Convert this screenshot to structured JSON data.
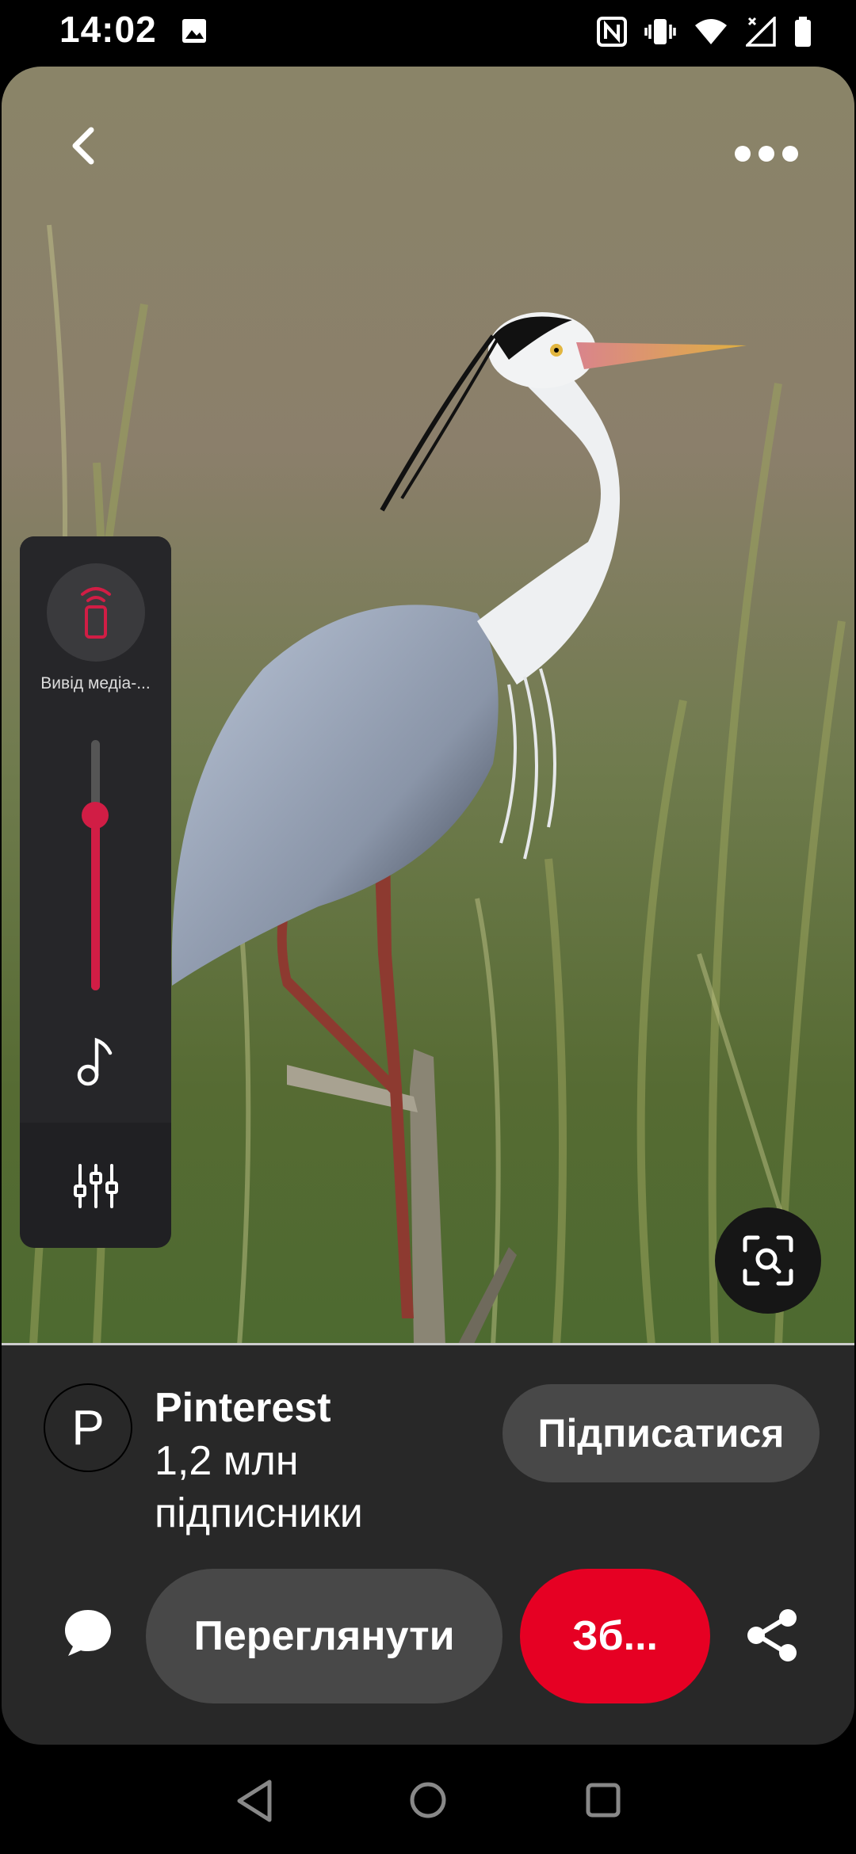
{
  "status_bar": {
    "time": "14:02",
    "icons": [
      "image-icon",
      "nfc-icon",
      "vibrate-icon",
      "wifi-icon",
      "signal-icon",
      "battery-icon"
    ]
  },
  "pin": {
    "image_subject": "grey-heron-photo",
    "actions": {
      "back_icon": "chevron-left-icon",
      "more_icon": "more-horizontal-icon",
      "lens_icon": "visual-search-icon"
    }
  },
  "volume_panel": {
    "media_output_label": "Вивід медіа-...",
    "volume_level": 0.7,
    "accent_color": "#d11d45",
    "icons": [
      "cast-device-icon",
      "music-note-icon",
      "equalizer-icon"
    ]
  },
  "creator": {
    "avatar_letter": "P",
    "name": "Pinterest",
    "followers": "1,2 млн підписники",
    "follow_label": "Підписатися"
  },
  "bottom_actions": {
    "comment_icon": "comment-icon",
    "visit_label": "Переглянути",
    "save_label": "Зб...",
    "save_color": "#e60023",
    "share_icon": "share-icon"
  },
  "nav_bar": {
    "icons": [
      "nav-back-icon",
      "nav-home-icon",
      "nav-recents-icon"
    ]
  }
}
